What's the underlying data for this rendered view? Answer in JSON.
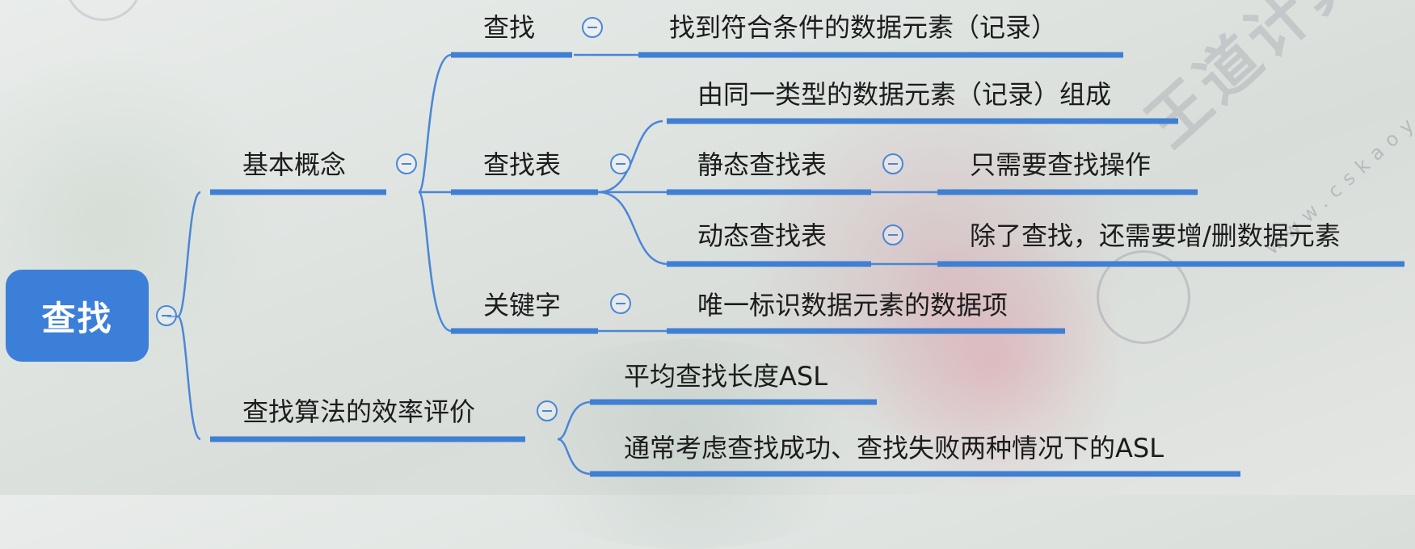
{
  "mindmap": {
    "root": "查找",
    "basic": {
      "label": "基本概念",
      "search": {
        "label": "查找",
        "desc": "找到符合条件的数据元素（记录）"
      },
      "table": {
        "label": "查找表",
        "desc": "由同一类型的数据元素（记录）组成",
        "static": {
          "label": "静态查找表",
          "desc": "只需要查找操作"
        },
        "dynamic": {
          "label": "动态查找表",
          "desc": "除了查找，还需要增/删数据元素"
        }
      },
      "key": {
        "label": "关键字",
        "desc": "唯一标识数据元素的数据项"
      }
    },
    "eval": {
      "label": "查找算法的效率评价",
      "asl": "平均查找长度ASL",
      "asl_cases": "通常考虑查找成功、查找失败两种情况下的ASL"
    }
  },
  "watermark": {
    "text": "王道计算机考研",
    "url": "www.cskaoyan.com"
  },
  "colors": {
    "root_fill": "#3c7fd8",
    "line": "#4a86d8",
    "toggle": "#4a86d8"
  }
}
